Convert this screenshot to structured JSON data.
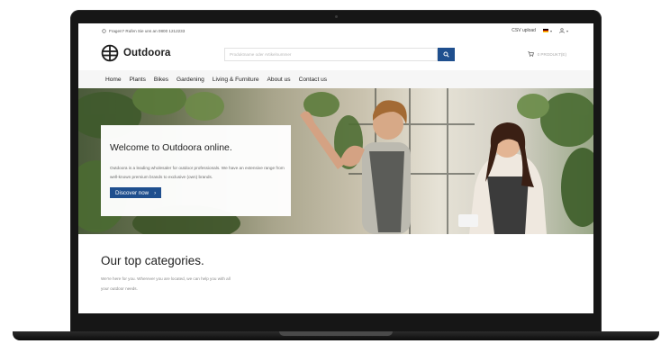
{
  "topbar": {
    "hotline": "Fragen? Rufen Sie uns an 0800 1212233",
    "csv_upload": "CSV upload",
    "language_icon": "german-flag-icon",
    "user_icon": "user-icon"
  },
  "header": {
    "logo_text": "Outdoora",
    "search_placeholder": "Produktname oder Artikelnummer",
    "search_icon": "search-icon",
    "cart_text": "0 PRODUKT(E)"
  },
  "nav": {
    "items": [
      "Home",
      "Plants",
      "Bikes",
      "Gardening",
      "Living & Furniture",
      "About us",
      "Contact us"
    ]
  },
  "hero": {
    "title": "Welcome to Outdoora online.",
    "text": "Outdoora is a leading wholesaler for outdoor professionals. We have an extensive range from well-known premium brands to exclusive (own) brands.",
    "button_label": "Discover now",
    "button_icon": "chevron-right-icon"
  },
  "categories": {
    "title": "Our top categories.",
    "text": "We're here for you. Wherever you are located, we can help you with all your outdoor needs."
  },
  "colors": {
    "primary": "#1f4f8e",
    "nav_bg": "#f6f6f6",
    "frame": "#161616"
  }
}
